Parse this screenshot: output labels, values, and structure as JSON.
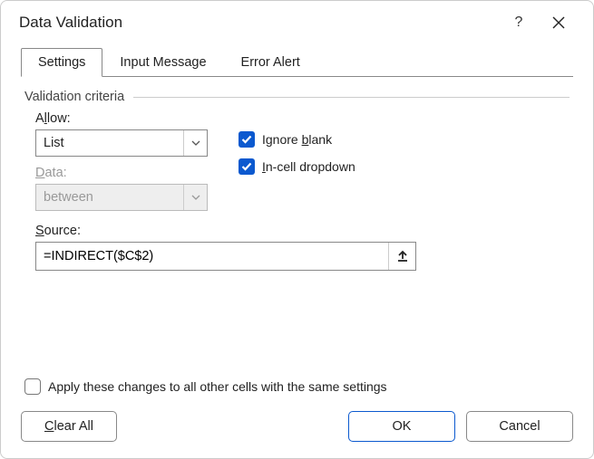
{
  "title": "Data Validation",
  "tabs": {
    "t0": "Settings",
    "t1": "Input Message",
    "t2": "Error Alert"
  },
  "group": "Validation criteria",
  "allow": {
    "label_pre": "A",
    "label_u": "l",
    "label_post": "low:",
    "value": "List"
  },
  "data": {
    "label_pre": "",
    "label_u": "D",
    "label_post": "ata:",
    "value": "between"
  },
  "source": {
    "label_pre": "",
    "label_u": "S",
    "label_post": "ource:",
    "value": "=INDIRECT($C$2)"
  },
  "checks": {
    "ignore_pre": "Ignore ",
    "ignore_u": "b",
    "ignore_post": "lank",
    "incell_pre": "",
    "incell_u": "I",
    "incell_post": "n-cell dropdown"
  },
  "apply_pre": "Apply these changes to all other cells with the same settings",
  "buttons": {
    "clear_pre": "",
    "clear_u": "C",
    "clear_post": "lear All",
    "ok": "OK",
    "cancel": "Cancel"
  }
}
